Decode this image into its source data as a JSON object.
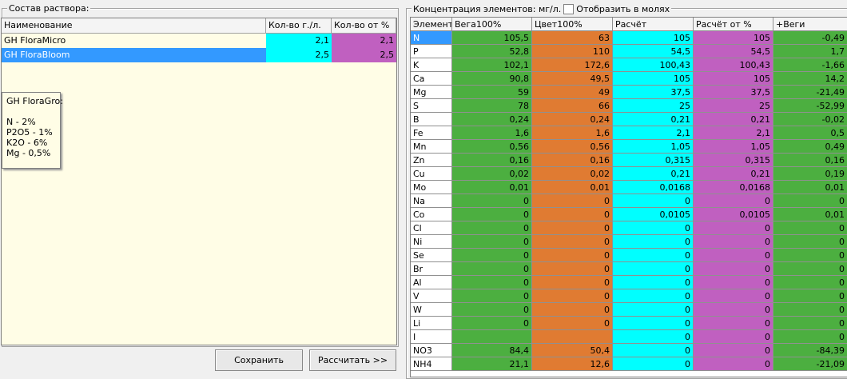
{
  "left_panel": {
    "title": "Состав раствора:",
    "columns": [
      "Наименование",
      "Кол-во г./л.",
      "Кол-во от %"
    ],
    "rows": [
      {
        "name": "GH FloraMicro",
        "qty": "2,1",
        "pct": "2,1"
      },
      {
        "name": "GH FloraBloom",
        "qty": "2,5",
        "pct": "2,5"
      }
    ],
    "tooltip": {
      "title": "GH FloraGro:",
      "lines": [
        "N - 2%",
        "P2O5 - 1%",
        "K2O - 6%",
        "Mg - 0,5%"
      ]
    },
    "save_label": "Сохранить",
    "calc_label": "Рассчитать >>"
  },
  "right_panel": {
    "title": "Концентрация элементов: мг/л.",
    "checkbox_label": "Отобразить в молях",
    "columns": [
      "Элемент",
      "Вега100%",
      "Цвет100%",
      "Расчёт",
      "Расчёт от %",
      "+Веги"
    ],
    "rows": [
      [
        "N",
        "105,5",
        "63",
        "105",
        "105",
        "-0,49"
      ],
      [
        "P",
        "52,8",
        "110",
        "54,5",
        "54,5",
        "1,7"
      ],
      [
        "K",
        "102,1",
        "172,6",
        "100,43",
        "100,43",
        "-1,66"
      ],
      [
        "Ca",
        "90,8",
        "49,5",
        "105",
        "105",
        "14,2"
      ],
      [
        "Mg",
        "59",
        "49",
        "37,5",
        "37,5",
        "-21,49"
      ],
      [
        "S",
        "78",
        "66",
        "25",
        "25",
        "-52,99"
      ],
      [
        "B",
        "0,24",
        "0,24",
        "0,21",
        "0,21",
        "-0,02"
      ],
      [
        "Fe",
        "1,6",
        "1,6",
        "2,1",
        "2,1",
        "0,5"
      ],
      [
        "Mn",
        "0,56",
        "0,56",
        "1,05",
        "1,05",
        "0,49"
      ],
      [
        "Zn",
        "0,16",
        "0,16",
        "0,315",
        "0,315",
        "0,16"
      ],
      [
        "Cu",
        "0,02",
        "0,02",
        "0,21",
        "0,21",
        "0,19"
      ],
      [
        "Mo",
        "0,01",
        "0,01",
        "0,0168",
        "0,0168",
        "0,01"
      ],
      [
        "Na",
        "0",
        "0",
        "0",
        "0",
        "0"
      ],
      [
        "Co",
        "0",
        "0",
        "0,0105",
        "0,0105",
        "0,01"
      ],
      [
        "Cl",
        "0",
        "0",
        "0",
        "0",
        "0"
      ],
      [
        "Ni",
        "0",
        "0",
        "0",
        "0",
        "0"
      ],
      [
        "Se",
        "0",
        "0",
        "0",
        "0",
        "0"
      ],
      [
        "Br",
        "0",
        "0",
        "0",
        "0",
        "0"
      ],
      [
        "Al",
        "0",
        "0",
        "0",
        "0",
        "0"
      ],
      [
        "V",
        "0",
        "0",
        "0",
        "0",
        "0"
      ],
      [
        "W",
        "0",
        "0",
        "0",
        "0",
        "0"
      ],
      [
        "Li",
        "0",
        "0",
        "0",
        "0",
        "0"
      ],
      [
        "I",
        "",
        "",
        "0",
        "0",
        "0"
      ],
      [
        "NO3",
        "84,4",
        "50,4",
        "0",
        "0",
        "-84,39"
      ],
      [
        "NH4",
        "21,1",
        "12,6",
        "0",
        "0",
        "-21,09"
      ]
    ]
  },
  "colors": {
    "vega": "#4caf40",
    "tsvet": "#e07b32",
    "calc": "#00ffff",
    "calc_pct": "#c060c0",
    "selection": "#3399ff"
  }
}
